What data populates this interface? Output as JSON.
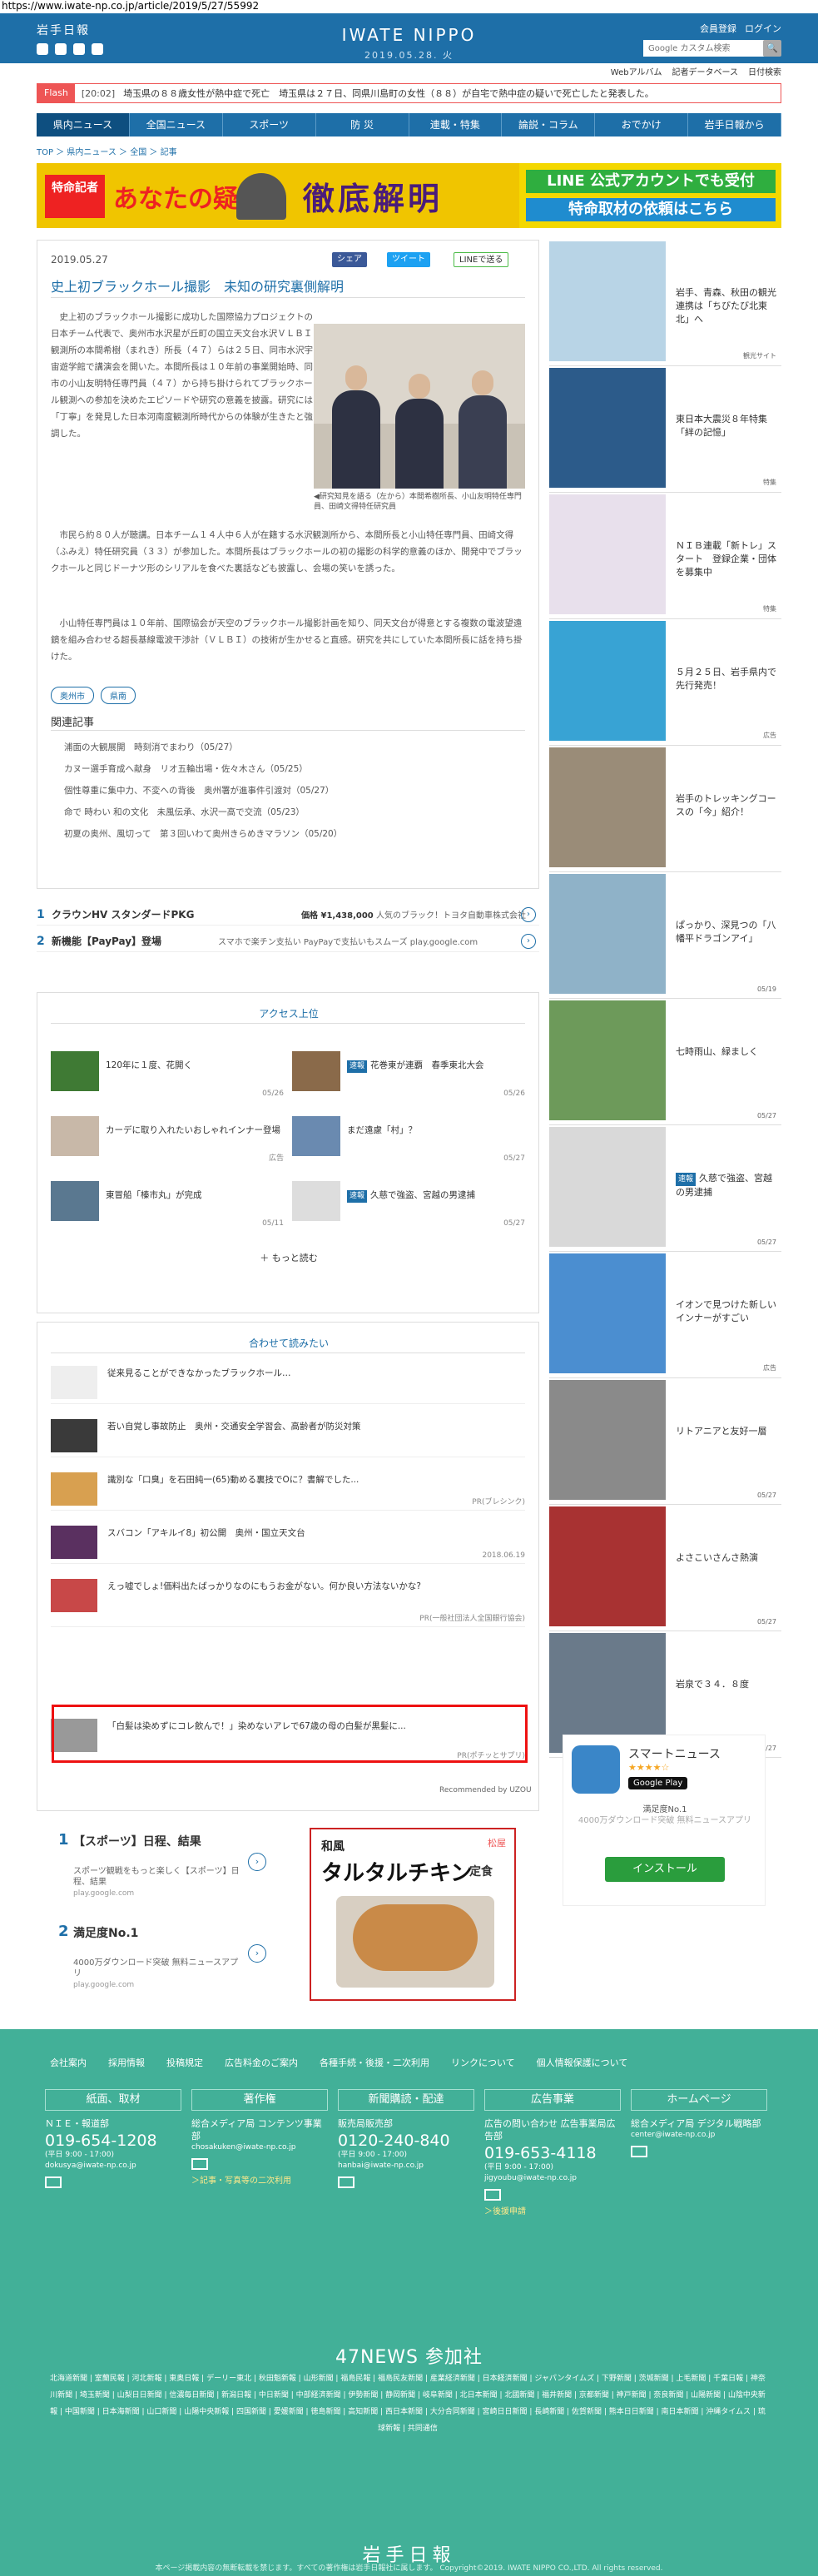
{
  "url": "https://www.iwate-np.co.jp/article/2019/5/27/55992",
  "header": {
    "logo": "岩手日報",
    "brand": "IWATE NIPPO",
    "date": "2019.05.28. 火",
    "member_register": "会員登録",
    "login": "ログイン",
    "search_placeholder": "Google カスタム検索",
    "search_btn": "🔍",
    "sublinks": [
      "Webアルバム",
      "記者データベース",
      "日付検索"
    ]
  },
  "flash": {
    "tag": "Flash",
    "time": "[20:02]",
    "text": "埼玉県の８８歳女性が熱中症で死亡　埼玉県は２７日、同県川島町の女性（８８）が自宅で熱中症の疑いで死亡したと発表した。"
  },
  "nav": [
    "県内ニュース",
    "全国ニュース",
    "スポーツ",
    "防 災",
    "連載・特集",
    "論説・コラム",
    "おでかけ",
    "岩手日報から"
  ],
  "breadcrumb": "TOP ＞ 県内ニュース ＞ 全国 ＞ 記事",
  "banner": {
    "tag": "特命記者",
    "text1": "あなたの疑問",
    "text2": "徹底解明",
    "line1": "LINE 公式アカウントでも受付",
    "line2": "特命取材の依頼はこちら"
  },
  "article": {
    "date": "2019.05.27",
    "share_fb": "シェア",
    "share_tw": "ツイート",
    "share_line": "LINEで送る",
    "title": "史上初ブラックホール撮影　未知の研究裏側解明",
    "p1": "史上初のブラックホール撮影に成功した国際協力プロジェクトの日本チーム代表で、奥州市水沢星が丘町の国立天文台水沢ＶＬＢＩ観測所の本間希樹（まれき）所長（４７）らは２５日、同市水沢宇宙遊学館で講演会を開いた。本間所長は１０年前の事業開始時、同市の小山友明特任専門員（４７）から持ち掛けられてブラックホール観測への参加を決めたエピソードや研究の意義を披露。研究には「丁寧」を発見した日本河南度観測所時代からの体験が生きたと強調した。",
    "caption": "◀研究知見を語る（左から）本間希樹所長、小山友明特任専門員、田崎文得特任研究員",
    "p2": "市民ら約８０人が聴講。日本チーム１４人中６人が在籍する水沢観測所から、本間所長と小山特任専門員、田崎文得（ふみえ）特任研究員（３３）が参加した。本間所長はブラックホールの初の撮影の科学的意義のほか、開発中でブラックホールと同じドーナツ形のシリアルを食べた裏話なども披露し、会場の笑いを誘った。",
    "p3": "小山特任専門員は１０年前、国際協会が天空のブラックホール撮影計画を知り、同天文台が得意とする複数の電波望遠鏡を組み合わせる超長基線電波干渉計（ＶＬＢＩ）の技術が生かせると直感。研究を共にしていた本間所長に話を持ち掛けた。",
    "tags": [
      "奥州市",
      "県南"
    ],
    "related_heading": "関連記事",
    "related": [
      "浦面の大観展開　時刻消でまわり（05/27）",
      "カヌー選手育成へ献身　リオ五輪出場・佐々木さん（05/25）",
      "個性尊重に集中力、不変への背後　奥州署が進事件引渡対（05/27）",
      "命で 時わい 和の文化　未風伝承、水沢一高で交流（05/23）",
      "初夏の奥州、風切って　第３回いわて奥州きらめきマラソン（05/20）"
    ]
  },
  "ads_text": [
    {
      "num": "1",
      "name": "クラウンHV スタンダードPKG",
      "price": "価格 ¥1,438,000",
      "desc": "人気のブラック！トヨタ自動車株式会社"
    },
    {
      "num": "2",
      "name": "新機能【PayPay】登場",
      "price": "",
      "desc": "スマホで楽チン支払い PayPayで支払いもスムーズ play.google.com"
    }
  ],
  "ranking": {
    "title": "アクセス上位",
    "more": "もっと読む",
    "items": [
      {
        "text": "120年に１度、花開く",
        "date": "05/26",
        "badge": ""
      },
      {
        "text": "花巻東が連覇　春季東北大会",
        "date": "05/26",
        "badge": "速報"
      },
      {
        "text": "カーデに取り入れたいおしゃれインナー登場",
        "date": "広告",
        "badge": ""
      },
      {
        "text": "まだ遠慮「村」？",
        "date": "05/27",
        "badge": ""
      },
      {
        "text": "東冒船「榛市丸」が完成",
        "date": "05/11",
        "badge": ""
      },
      {
        "text": "久慈で強盗、宮越の男逮捕",
        "date": "05/27",
        "badge": "速報"
      }
    ]
  },
  "recommend": {
    "title": "合わせて読みたい",
    "items": [
      {
        "text": "従来見ることができなかったブラックホール…",
        "src": ""
      },
      {
        "text": "若い自覚し事故防止　奥州・交通安全学習会、高齢者が防災対策",
        "src": ""
      },
      {
        "text": "識別な「口臭」を石田純一(65)動める裏技でOに？書解でした...",
        "src": "PR(ブレシンク)"
      },
      {
        "text": "スバコン「アキルイ8」初公開　奥州・国立天文台",
        "src": "2018.06.19"
      },
      {
        "text": "えっ嘘でしょ!価料出たばっかりなのにもうお金がない。何か良い方法ないかな?",
        "src": "PR(一般社団法人全国銀行協会)"
      },
      {
        "text": "「白髪は染めずにコレ飲んで！」染めないアレで67歳の母の白髪が黒髪に...",
        "src": "PR(ポチッとサプリ)"
      }
    ],
    "recommended_by": "Recommended by UZOU"
  },
  "ads_bottom": [
    {
      "num": "1",
      "title": "【スポーツ】日程、結果",
      "desc": "スポーツ観戦をもっと楽しく【スポーツ】日程、結果",
      "url": "play.google.com"
    },
    {
      "num": "2",
      "title": "満足度No.1",
      "desc": "4000万ダウンロード突破 無料ニュースアプリ",
      "url": "play.google.com"
    }
  ],
  "food_ad": {
    "a1": "和風",
    "a2": "タルタルチキン",
    "a3": "定食",
    "brand": "松屋"
  },
  "sidebar": [
    {
      "text": "岩手、青森、秋田の観光連携は「ちびたび北東北」へ",
      "date": "観光サイト",
      "badge": "",
      "img": "#b8d4e6"
    },
    {
      "text": "東日本大震災８年特集「絆の記憶」",
      "date": "特集",
      "badge": "",
      "img": "#2c5b8a"
    },
    {
      "text": "ＮＩＢ連載「新トレ」スタート　登録企業・団体を募集中",
      "date": "特集",
      "badge": "",
      "img": "#e8e0ec"
    },
    {
      "text": "５月２５日、岩手県内で先行発売！",
      "date": "広告",
      "badge": "",
      "img": "#38a3d4"
    },
    {
      "text": "岩手のトレッキングコースの「今」紹介！",
      "date": "",
      "badge": "",
      "img": "#9a8c78"
    },
    {
      "text": "ぱっかり、深見つの「八幡平ドラゴンアイ」",
      "date": "05/19",
      "badge": "",
      "img": "#8fb2c8"
    },
    {
      "text": "七時雨山、緑ましく",
      "date": "05/27",
      "badge": "",
      "img": "#6d9a5a"
    },
    {
      "text": "久慈で強盗、宮越の男逮捕",
      "date": "05/27",
      "badge": "速報",
      "img": "#d9d9d9"
    },
    {
      "text": "イオンで見つけた新しいインナーがすごい",
      "date": "広告",
      "badge": "",
      "img": "#4b8ed0"
    },
    {
      "text": "リトアニアと友好一層",
      "date": "05/27",
      "badge": "",
      "img": "#8a8a8a"
    },
    {
      "text": "よさこいさんさ熱演",
      "date": "05/27",
      "badge": "",
      "img": "#a83232"
    },
    {
      "text": "岩泉で３４．８度",
      "date": "05/27",
      "badge": "",
      "img": "#6a7a8a"
    }
  ],
  "app_ad": {
    "name": "スマートニュース",
    "stars": "★★★★☆",
    "store": "Google Play",
    "line1": "満足度No.1",
    "line2": "4000万ダウンロード突破 無料ニュースアプリ",
    "btn": "インストール"
  },
  "footer": {
    "links": [
      "会社案内",
      "採用情報",
      "投稿規定",
      "広告料金のご案内",
      "各種手続・後援・二次利用",
      "リンクについて",
      "個人情報保護について"
    ],
    "cols": [
      {
        "h": "紙面、取材",
        "p": "ＮＩＥ・報道部",
        "tel": "019-654-1208",
        "sm": "(平日 9:00 - 17:00)",
        "mail": "dokusya@iwate-np.co.jp",
        "lnk": ""
      },
      {
        "h": "著作権",
        "p": "総合メディア局 コンテンツ事業部",
        "tel": "",
        "sm": "",
        "mail": "chosakuken@iwate-np.co.jp",
        "lnk": "＞記事・写真等の二次利用"
      },
      {
        "h": "新聞購読・配達",
        "p": "販売局販売部",
        "tel": "0120-240-840",
        "sm": "(平日 9:00 - 17:00)",
        "mail": "hanbai@iwate-np.co.jp",
        "lnk": ""
      },
      {
        "h": "広告事業",
        "p": "広告の問い合わせ 広告事業局広告部",
        "tel": "019-653-4118",
        "sm": "(平日 9:00 - 17:00)",
        "mail": "jigyoubu@iwate-np.co.jp",
        "lnk": "＞後援申請"
      },
      {
        "h": "ホームページ",
        "p": "総合メディア局 デジタル戦略部",
        "tel": "",
        "sm": "",
        "mail": "center@iwate-np.co.jp",
        "lnk": ""
      }
    ],
    "n47_title": "47NEWS 参加社",
    "n47_list": "北海道新聞 | 室蘭民報 | 河北新報 | 東奥日報 | デーリー東北 | 秋田魁新報 | 山形新聞 | 福島民報 | 福島民友新聞 | 産業経済新聞 | 日本経済新聞 | ジャパンタイムズ | 下野新聞 | 茨城新聞 | 上毛新聞 | 千葉日報 | 神奈川新聞 | 埼玉新聞 | 山梨日日新聞 | 信濃毎日新聞 | 新潟日報 | 中日新聞 | 中部経済新聞 | 伊勢新聞 | 静岡新聞 | 岐阜新聞 | 北日本新聞 | 北國新聞 | 福井新聞 | 京都新聞 | 神戸新聞 | 奈良新聞 | 山陽新聞 | 山陰中央新報 | 中国新聞 | 日本海新聞 | 山口新聞 | 山陽中央新報 | 四国新聞 | 愛媛新聞 | 徳島新聞 | 高知新聞 | 西日本新聞 | 大分合同新聞 | 宮崎日日新聞 | 長崎新聞 | 佐賀新聞 | 熊本日日新聞 | 南日本新聞 | 沖縄タイムス | 琉球新報 | 共同通信",
    "logo": "岩手日報",
    "note": "本ページ掲載内容の無断転載を禁じます。すべての著作権は岩手日報社に属します。 Copyright©2019. IWATE NIPPO CO.,LTD. All rights reserved."
  },
  "colors": {
    "brand_blue": "#1e6fa8",
    "footer_green": "#42b098",
    "flash_red": "#e55"
  }
}
